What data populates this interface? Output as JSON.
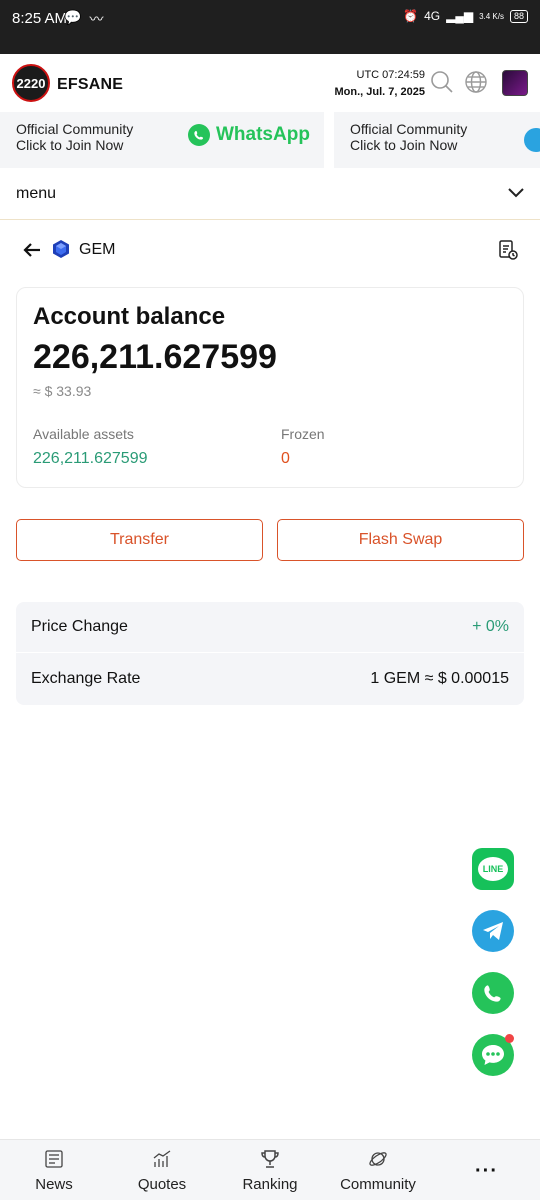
{
  "status_bar": {
    "time": "8:25 AM",
    "network": "4G",
    "speed": "3.4 K/s",
    "battery": "88"
  },
  "header": {
    "brand": "EFSANE",
    "logo_text": "2220",
    "utc_time": "UTC 07:24:59",
    "date": "Mon., Jul. 7, 2025"
  },
  "banner": {
    "items": [
      {
        "line1": "Official Community",
        "line2": "Click to Join Now",
        "app": "WhatsApp"
      },
      {
        "line1": "Official Community",
        "line2": "Click to Join Now",
        "app": ""
      }
    ]
  },
  "menu": {
    "label": "menu"
  },
  "page": {
    "title": "GEM"
  },
  "balance": {
    "heading": "Account balance",
    "amount": "226,211.627599",
    "usd": "≈ $ 33.93",
    "available_label": "Available assets",
    "available_value": "226,211.627599",
    "frozen_label": "Frozen",
    "frozen_value": "0"
  },
  "actions": {
    "transfer": "Transfer",
    "flash_swap": "Flash Swap"
  },
  "info": {
    "price_change_label": "Price Change",
    "price_change_value": "+ 0%",
    "exchange_rate_label": "Exchange Rate",
    "exchange_rate_value": "1 GEM ≈ $ 0.00015"
  },
  "fab": {
    "line_label": "LINE"
  },
  "bottom_nav": [
    {
      "label": "News",
      "icon": "news-icon"
    },
    {
      "label": "Quotes",
      "icon": "quotes-icon"
    },
    {
      "label": "Ranking",
      "icon": "trophy-icon"
    },
    {
      "label": "Community",
      "icon": "planet-icon"
    },
    {
      "label": "",
      "icon": "more-icon"
    }
  ],
  "colors": {
    "accent": "#d9532a",
    "green": "#2a9b76",
    "frozen": "#e0501e"
  }
}
